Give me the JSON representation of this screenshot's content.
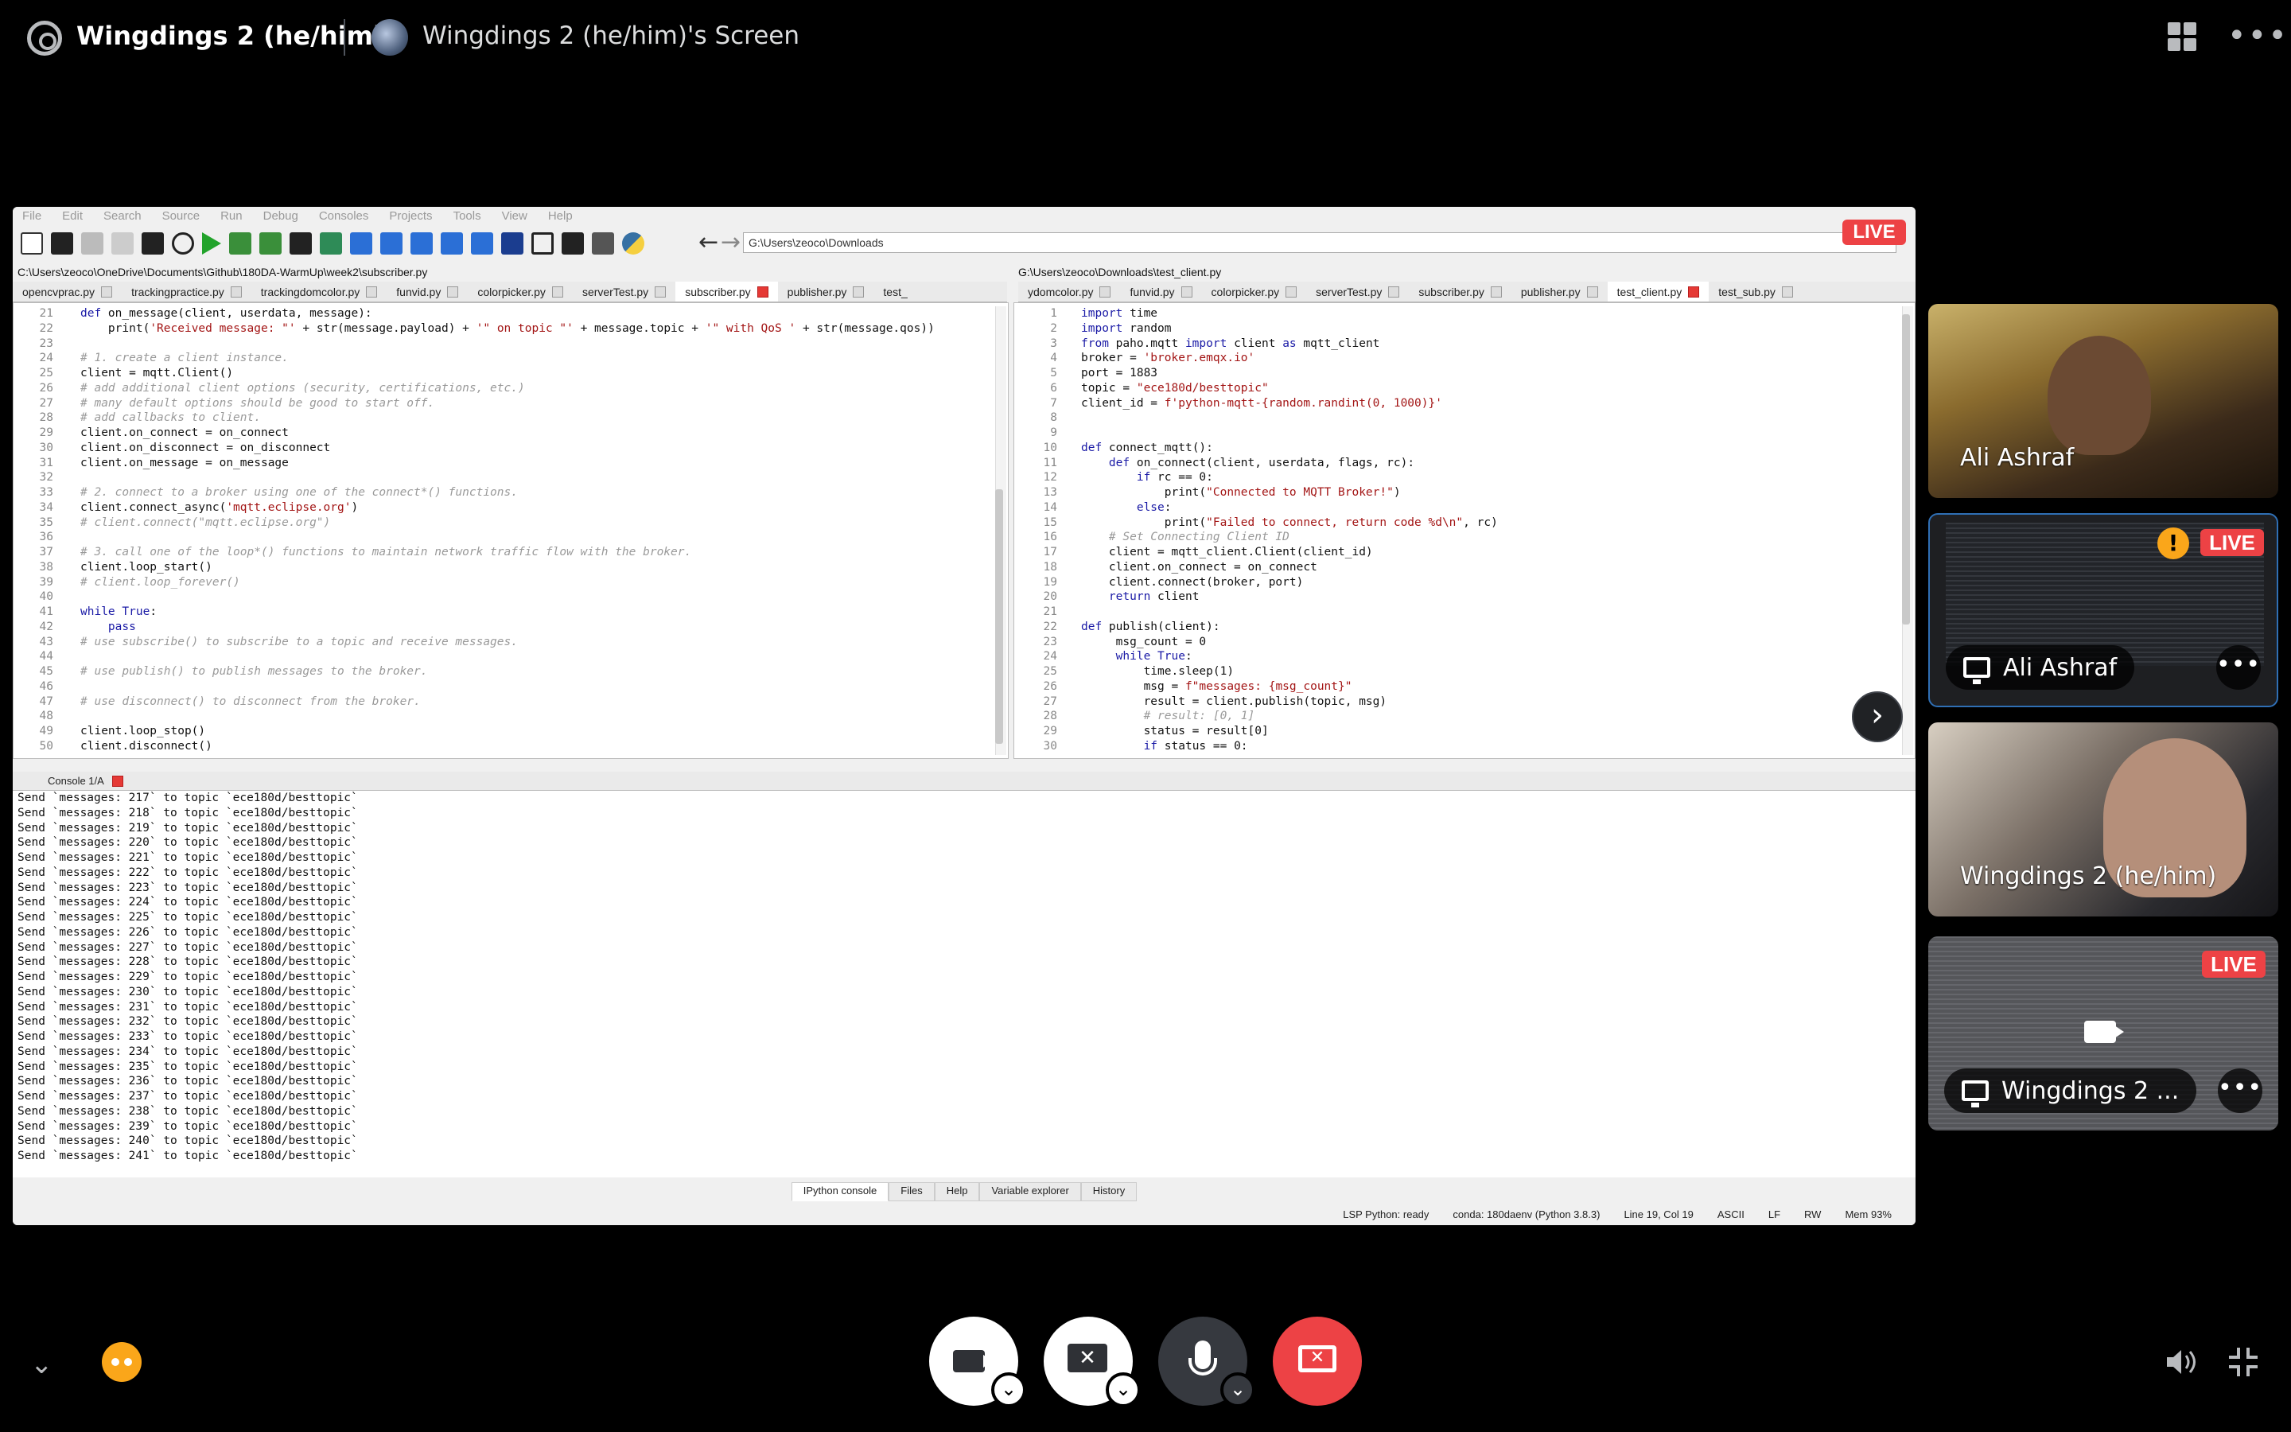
{
  "topbar": {
    "user": "Wingdings 2 (he/him)",
    "screen_title": "Wingdings 2 (he/him)'s Screen"
  },
  "ide": {
    "menu": [
      "File",
      "Edit",
      "Search",
      "Source",
      "Run",
      "Debug",
      "Consoles",
      "Projects",
      "Tools",
      "View",
      "Help"
    ],
    "path_box": "G:\\Users\\zeoco\\Downloads",
    "live": "LIVE",
    "left_path": "C:\\Users\\zeoco\\OneDrive\\Documents\\Github\\180DA-WarmUp\\week2\\subscriber.py",
    "right_path": "G:\\Users\\zeoco\\Downloads\\test_client.py",
    "left_tabs": [
      "opencvprac.py",
      "trackingpractice.py",
      "trackingdomcolor.py",
      "funvid.py",
      "colorpicker.py",
      "serverTest.py",
      "subscriber.py",
      "publisher.py",
      "test_"
    ],
    "right_tabs": [
      "ydomcolor.py",
      "funvid.py",
      "colorpicker.py",
      "serverTest.py",
      "subscriber.py",
      "publisher.py",
      "test_client.py",
      "test_sub.py"
    ],
    "left_active_tab": "subscriber.py",
    "right_active_tab": "test_client.py",
    "console_tab": "Console 1/A",
    "bottom_tabs": [
      "IPython console",
      "Files",
      "Help",
      "Variable explorer",
      "History"
    ],
    "status": [
      "LSP Python: ready",
      "conda: 180daenv (Python 3.8.3)",
      "Line 19, Col 19",
      "ASCII",
      "LF",
      "RW",
      "Mem 93%"
    ]
  },
  "participants": [
    {
      "name": "Ali Ashraf"
    },
    {
      "name": "Ali Ashraf",
      "live": "LIVE",
      "warn": "!"
    },
    {
      "name": "Wingdings 2 (he/him)"
    },
    {
      "name": "Wingdings 2 ...",
      "live": "LIVE"
    }
  ],
  "colors": {
    "live": "#ed4245",
    "end_call": "#ed4245",
    "warn": "#faa61a"
  }
}
